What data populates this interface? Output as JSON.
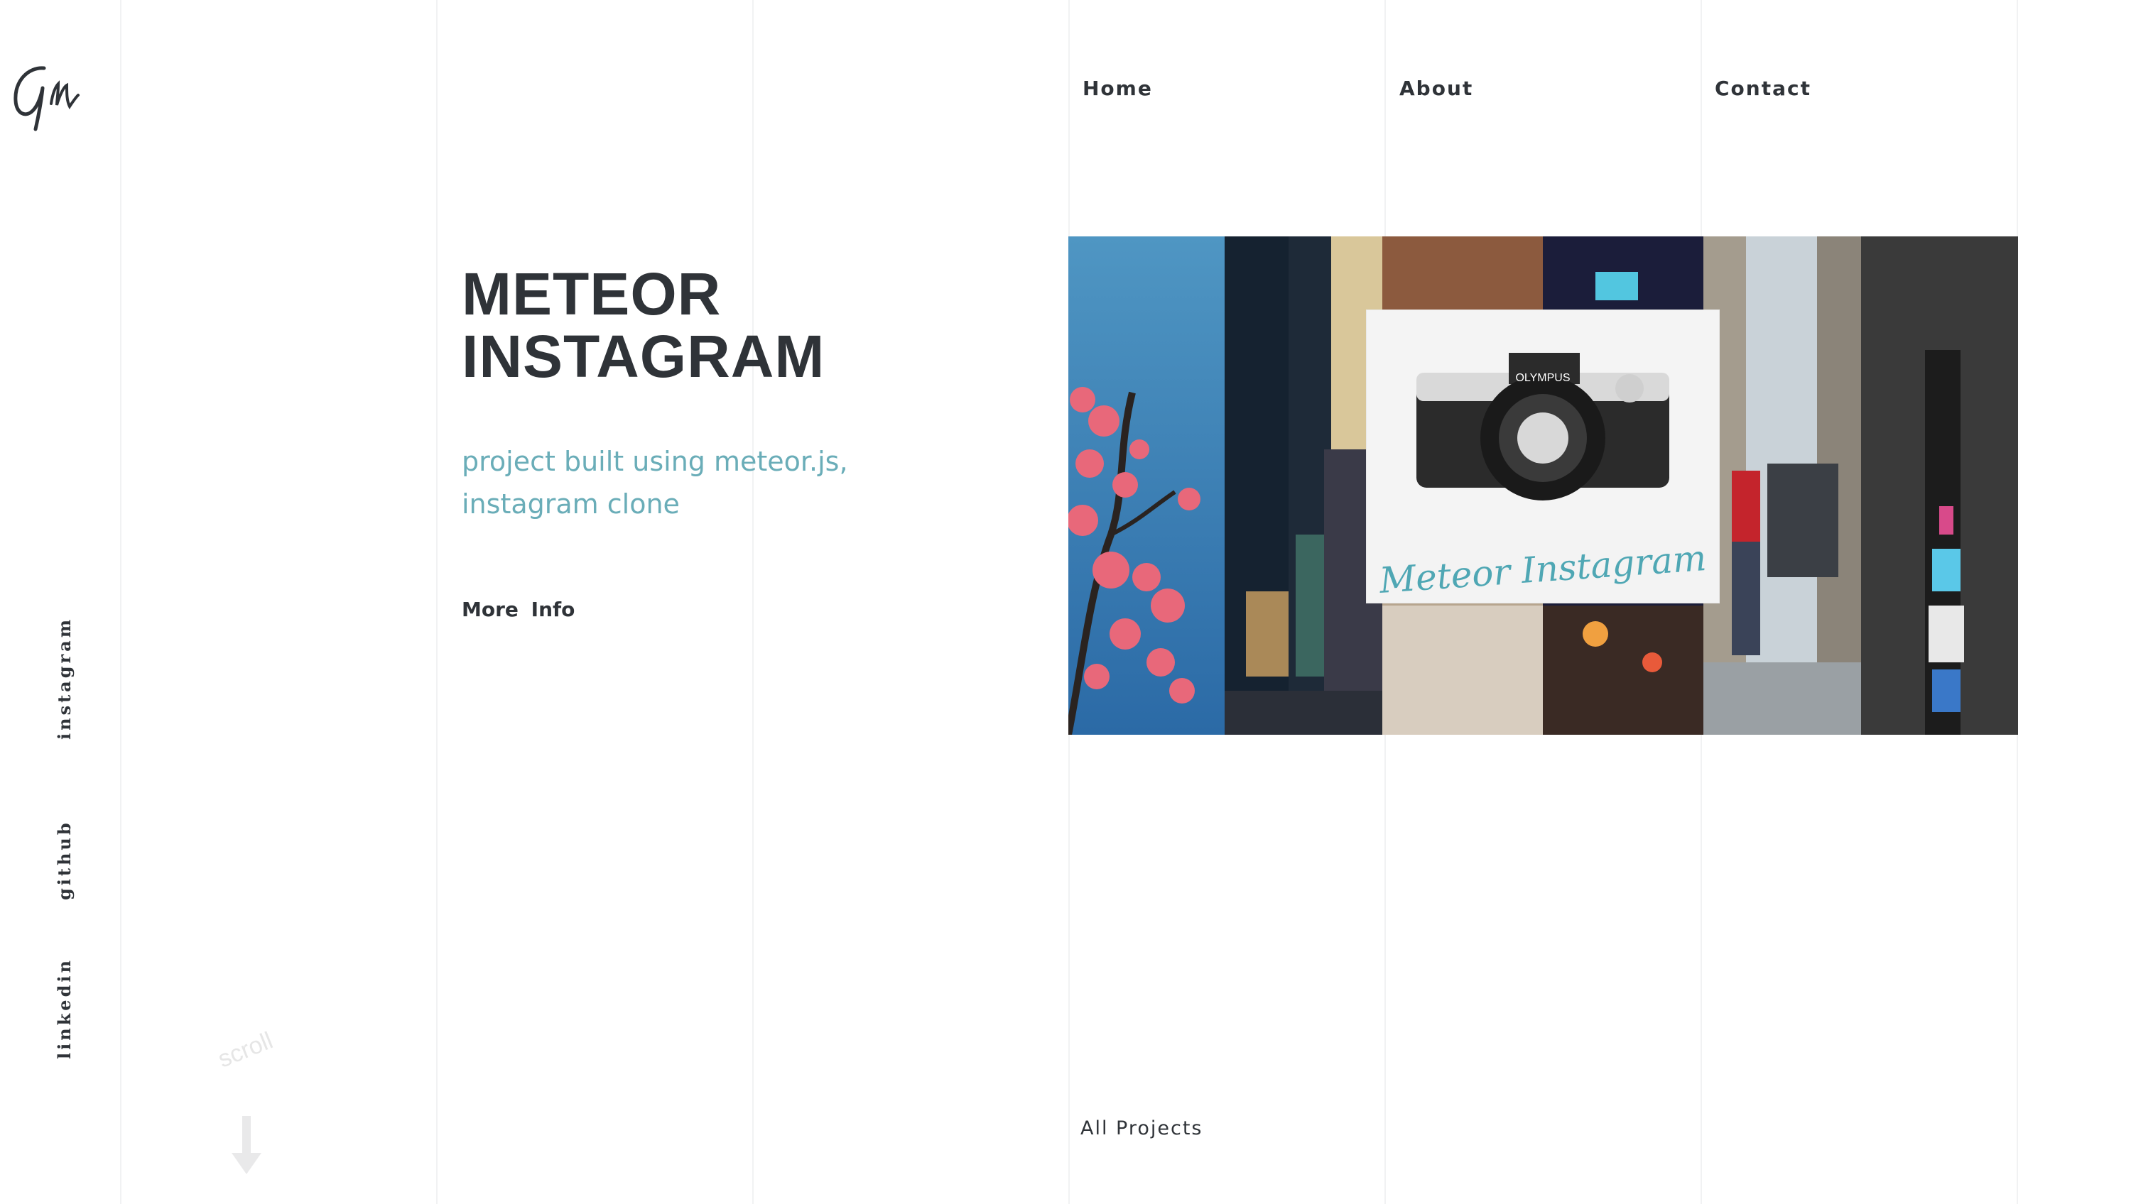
{
  "logo": {
    "text": "GM",
    "icon": "signature-logo-icon"
  },
  "nav": {
    "home": "Home",
    "about": "About",
    "contact": "Contact"
  },
  "social": {
    "instagram": "instagram",
    "github": "github",
    "linkedin": "linkedin"
  },
  "hero": {
    "title_line1": "METEOR",
    "title_line2": "INSTAGRAM",
    "subtitle_line1": "project built using meteor.js,",
    "subtitle_line2": "instagram clone",
    "more_info": "More  Info"
  },
  "collage": {
    "caption": "Meteor Instagram",
    "camera_brand": "OLYMPUS"
  },
  "scroll": {
    "label": "scroll",
    "icon": "down-arrow-icon"
  },
  "footer": {
    "all_projects": "All Projects"
  },
  "colors": {
    "text": "#2f3338",
    "accent": "#6aadb8",
    "grid": "#f1f2f3"
  }
}
